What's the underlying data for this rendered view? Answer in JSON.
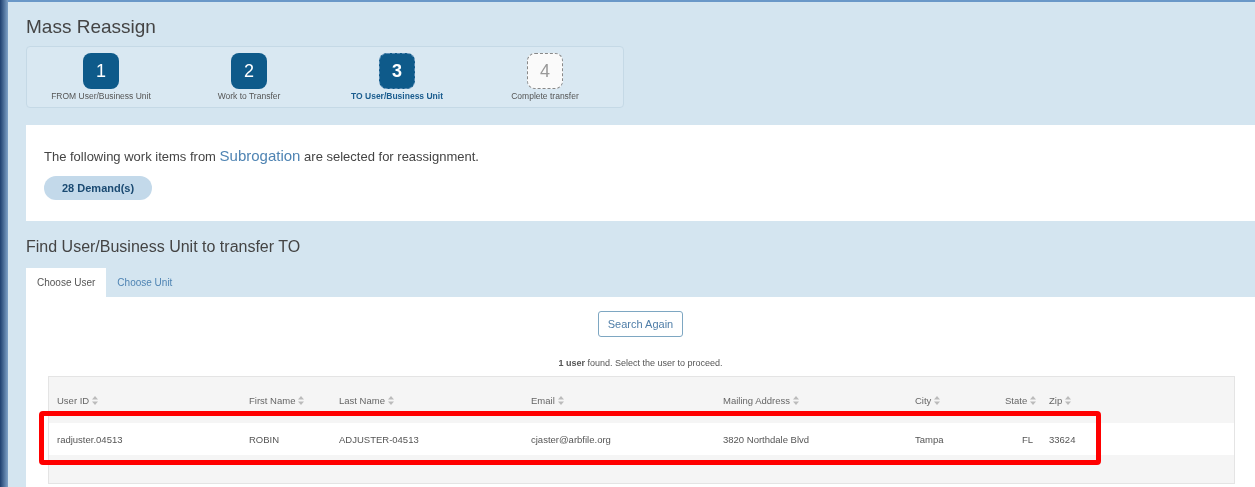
{
  "title": "Mass Reassign",
  "steps": [
    {
      "number": "1",
      "label": "FROM User/Business Unit",
      "selected": false,
      "completed": true
    },
    {
      "number": "2",
      "label": "Work to Transfer",
      "selected": false,
      "completed": true
    },
    {
      "number": "3",
      "label": "TO User/Business Unit",
      "selected": true,
      "completed": false
    },
    {
      "number": "4",
      "label": "Complete transfer",
      "selected": false,
      "completed": false
    }
  ],
  "summary": {
    "before": "The following work items from ",
    "link": "Subrogation",
    "after": " are selected for reassignment.",
    "badge": "28 Demand(s)"
  },
  "section_title": "Find User/Business Unit to transfer TO",
  "tabs": [
    {
      "label": "Choose User",
      "selected": true
    },
    {
      "label": "Choose Unit",
      "selected": false
    }
  ],
  "search_button": "Search Again",
  "result_count": {
    "bold": "1 user",
    "rest": " found. Select the user to proceed."
  },
  "table": {
    "columns": [
      "User ID",
      "First Name",
      "Last Name",
      "Email",
      "Mailing Address",
      "City",
      "State",
      "Zip"
    ],
    "rows": [
      {
        "cells": [
          "radjuster.04513",
          "ROBIN",
          "ADJUSTER-04513",
          "cjaster@arbfile.org",
          "3820 Northdale Blvd",
          "Tampa",
          "FL",
          "33624"
        ],
        "highlighted": true
      }
    ]
  }
}
